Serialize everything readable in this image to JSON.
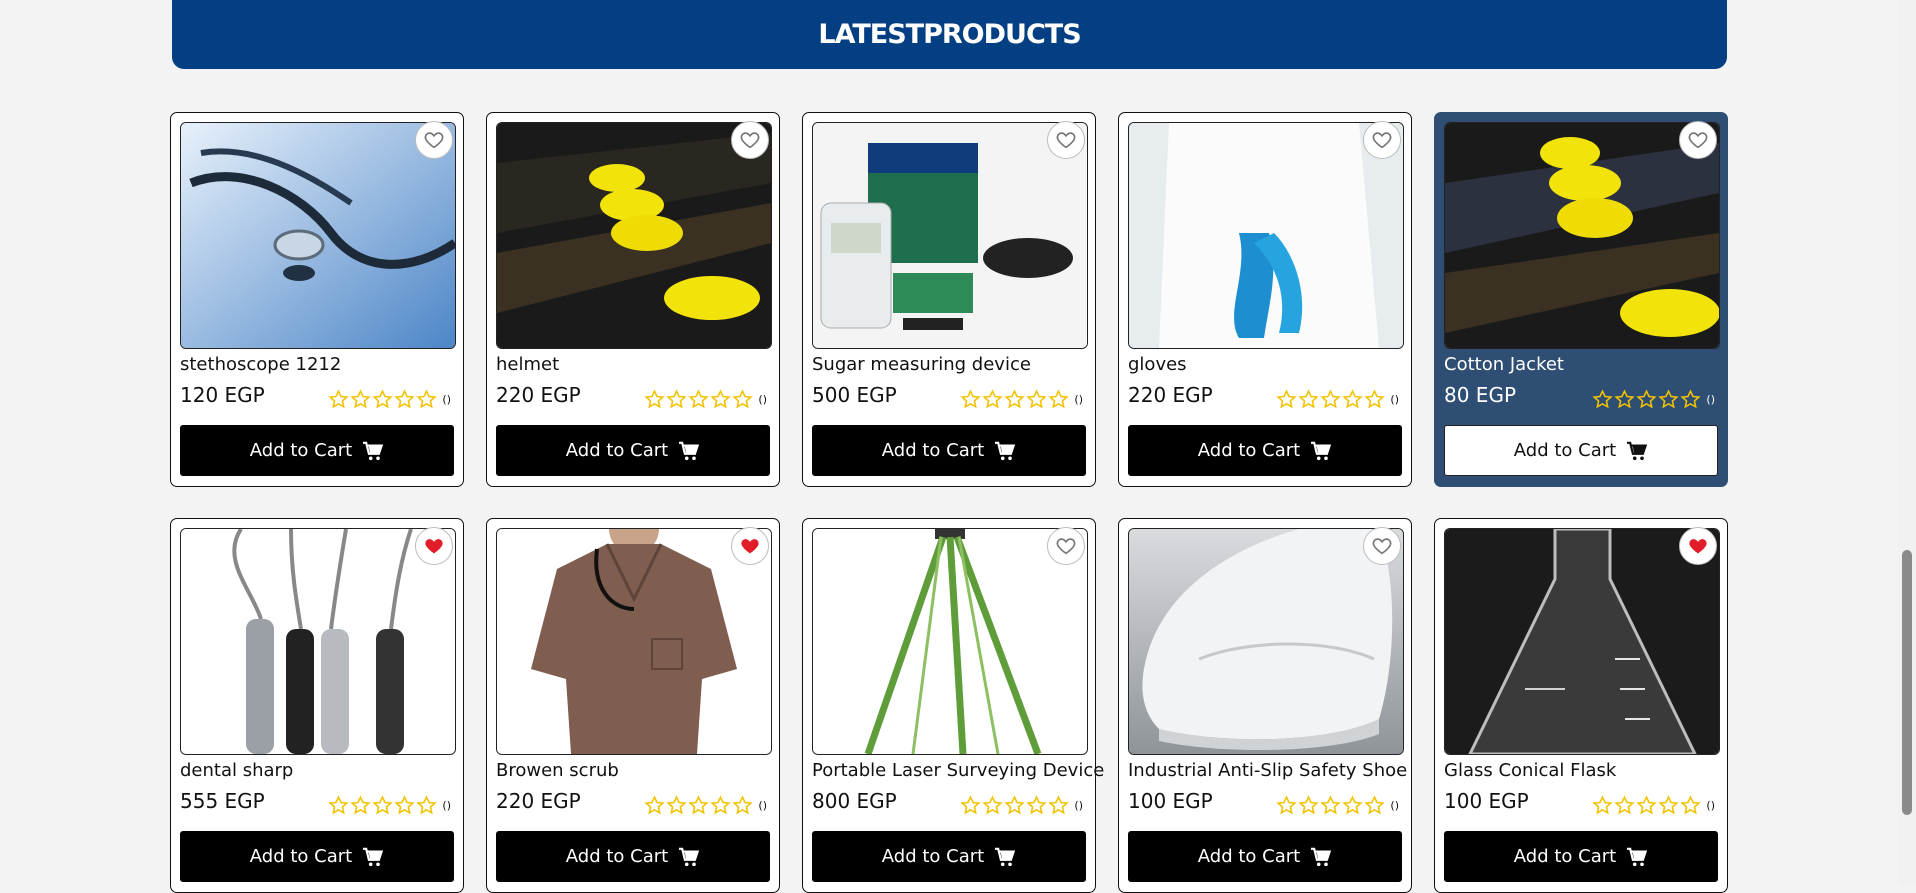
{
  "section_title": "LATESTPRODUCTS",
  "cart_label": "Add to Cart",
  "colors": {
    "banner": "#043f84",
    "highlight": "#2e4e73",
    "star": "#f2c200",
    "heart": "#e11d2a"
  },
  "products": [
    {
      "name": "stethoscope 1212",
      "price": "120 EGP",
      "reviews": "()",
      "favorited": false,
      "image": "stethoscope"
    },
    {
      "name": "helmet",
      "price": "220 EGP",
      "reviews": "()",
      "favorited": false,
      "image": "yellow-helmets"
    },
    {
      "name": "Sugar measuring device",
      "price": "500 EGP",
      "reviews": "()",
      "favorited": false,
      "image": "glucose-meter-kit"
    },
    {
      "name": "gloves",
      "price": "220 EGP",
      "reviews": "()",
      "favorited": false,
      "image": "blue-gloves"
    },
    {
      "name": "Cotton Jacket",
      "price": "80 EGP",
      "reviews": "()",
      "favorited": false,
      "image": "yellow-helmets",
      "highlighted": true
    },
    {
      "name": "dental sharp",
      "price": "555 EGP",
      "reviews": "()",
      "favorited": true,
      "image": "dental-tools"
    },
    {
      "name": "Browen scrub",
      "price": "220 EGP",
      "reviews": "()",
      "favorited": true,
      "image": "brown-scrub"
    },
    {
      "name": "Portable Laser Surveying Device",
      "price": "800 EGP",
      "reviews": "()",
      "favorited": false,
      "image": "tripod"
    },
    {
      "name": "Industrial Anti-Slip Safety Shoe",
      "price": "100 EGP",
      "reviews": "()",
      "favorited": false,
      "image": "white-shoe"
    },
    {
      "name": "Glass Conical Flask",
      "price": "100 EGP",
      "reviews": "()",
      "favorited": true,
      "image": "conical-flask"
    }
  ]
}
